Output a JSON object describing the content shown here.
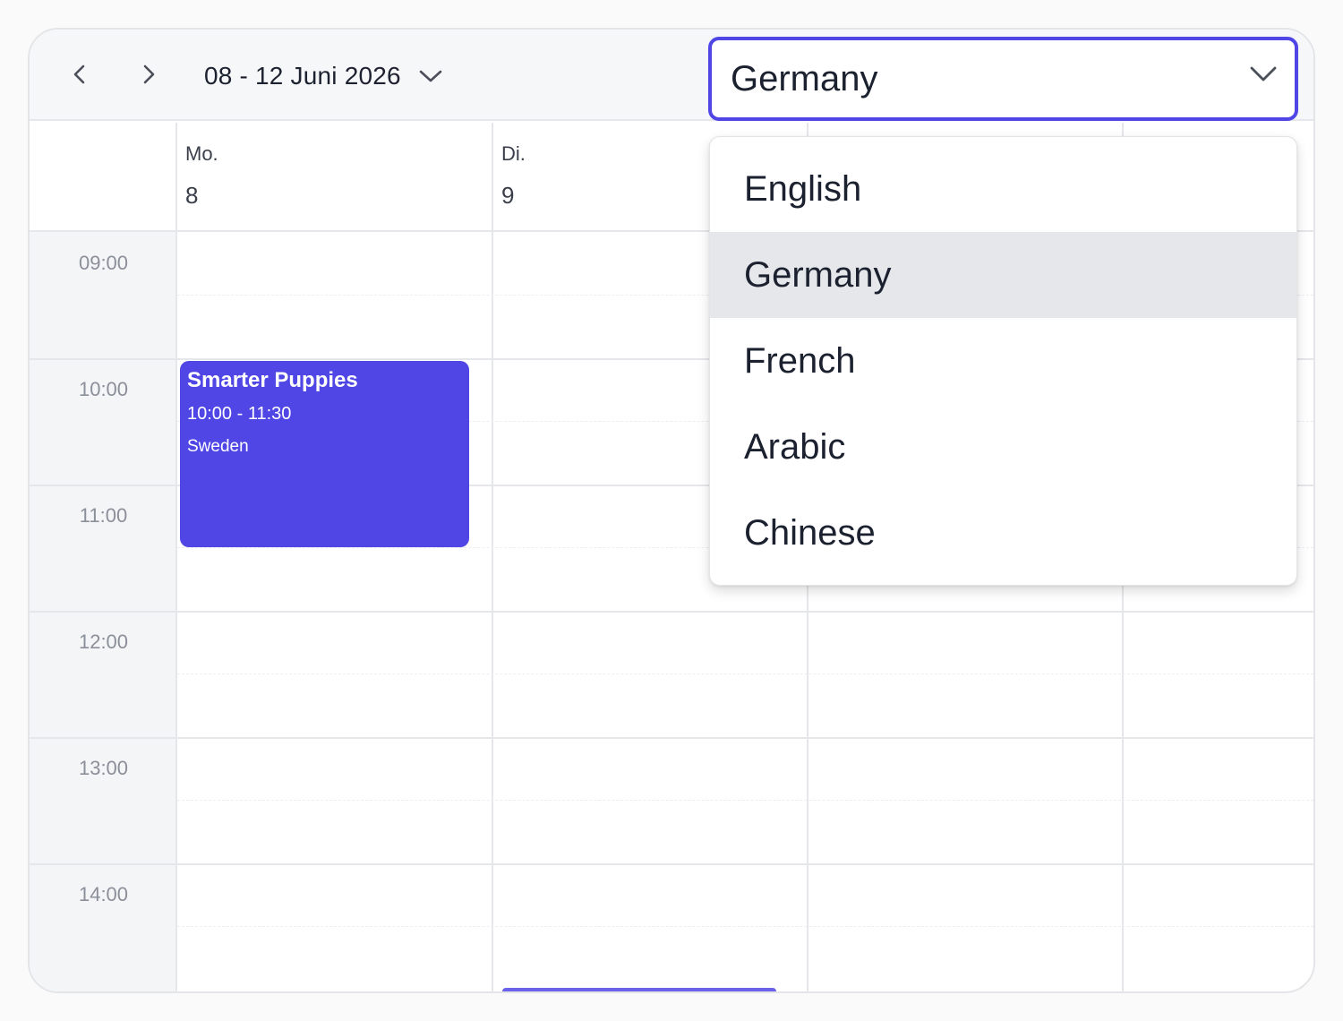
{
  "toolbar": {
    "range_label": "08 - 12 Juni 2026",
    "prev_icon": "chevron-left-icon",
    "next_icon": "chevron-right-icon"
  },
  "select": {
    "value": "Germany",
    "options": [
      "English",
      "Germany",
      "French",
      "Arabic",
      "Chinese"
    ],
    "selected_index": 1
  },
  "days": [
    {
      "name": "Mo.",
      "num": "8"
    },
    {
      "name": "Di.",
      "num": "9"
    }
  ],
  "times": [
    "09:00",
    "10:00",
    "11:00",
    "12:00",
    "13:00",
    "14:00"
  ],
  "event": {
    "title": "Smarter Puppies",
    "time": "10:00 - 11:30",
    "location": "Sweden"
  },
  "colors": {
    "accent": "#4f46e5",
    "selected_option_bg": "#e6e7ea",
    "time_column_bg": "#f4f5f7"
  }
}
